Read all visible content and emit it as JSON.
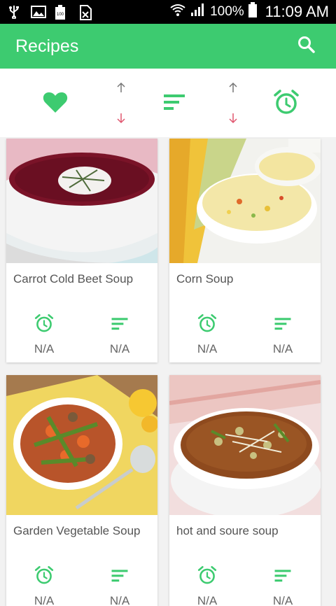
{
  "status_bar": {
    "battery_percent": "100%",
    "time": "11:09 AM"
  },
  "app_bar": {
    "title": "Recipes",
    "search_icon": "search-icon"
  },
  "sort_bar": {
    "favorite_icon": "heart-icon",
    "sort_icon": "sort-lines-icon",
    "time_icon": "alarm-clock-icon",
    "arrow_up_icon": "arrow-up-icon",
    "arrow_down_icon": "arrow-down-icon"
  },
  "colors": {
    "primary": "#3dcb70",
    "arrow_up": "#777777",
    "arrow_down": "#e0566f"
  },
  "recipes": [
    {
      "title": "Carrot Cold Beet Soup",
      "time": "N/A",
      "difficulty": "N/A"
    },
    {
      "title": "Corn Soup",
      "time": "N/A",
      "difficulty": "N/A"
    },
    {
      "title": "Garden Vegetable Soup",
      "time": "N/A",
      "difficulty": "N/A"
    },
    {
      "title": "hot and soure soup",
      "time": "N/A",
      "difficulty": "N/A"
    }
  ]
}
